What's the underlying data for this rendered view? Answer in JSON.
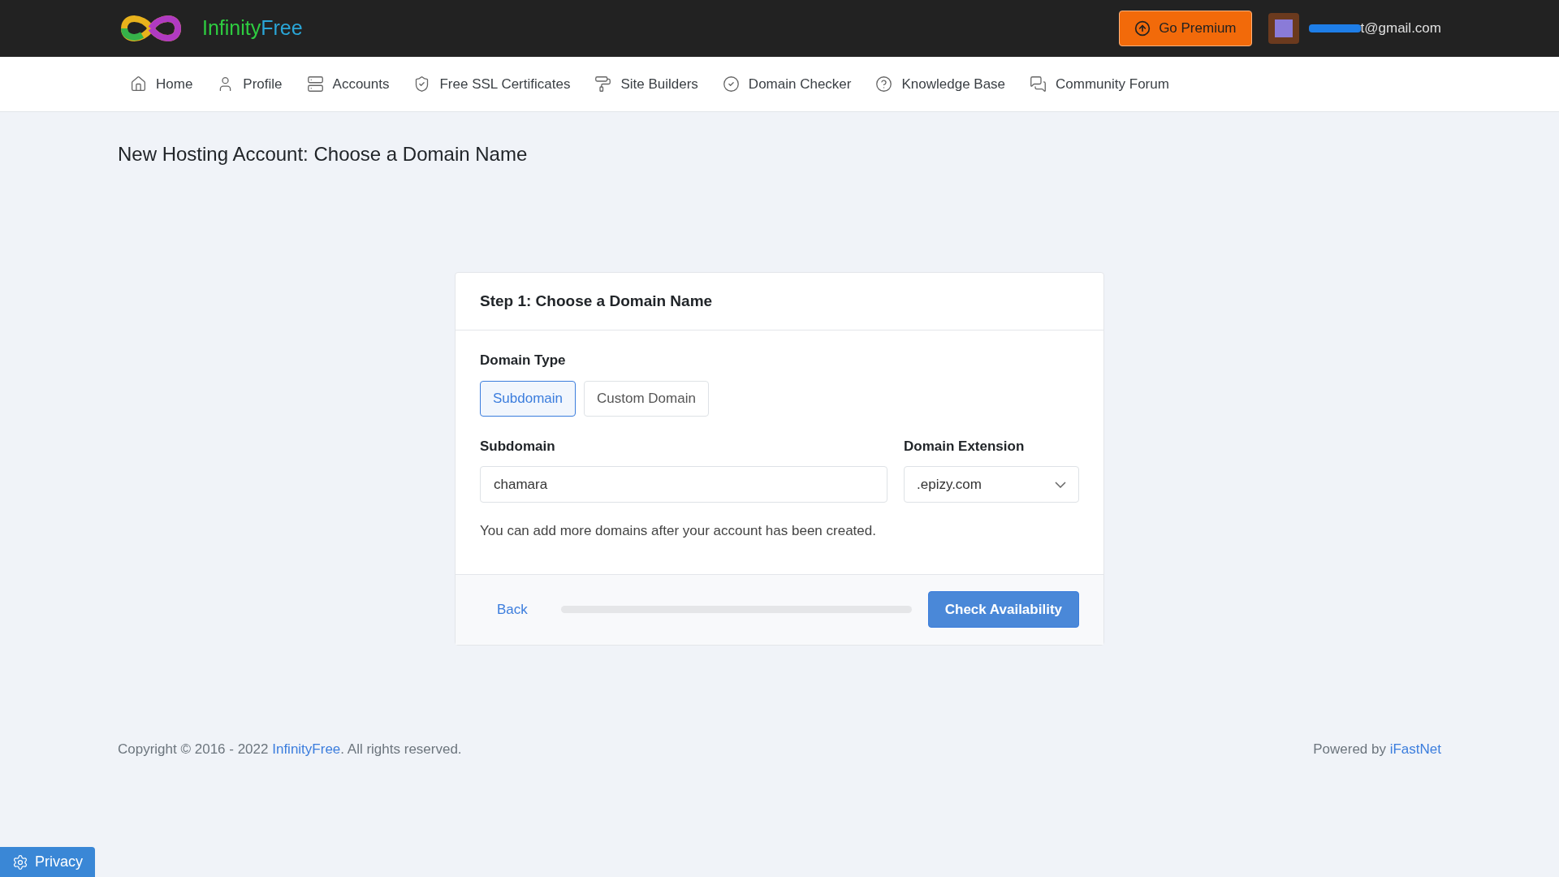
{
  "brand": {
    "name_part_1": "Infinity",
    "name_part_2": "Free"
  },
  "header": {
    "premium_button": "Go Premium",
    "user_email": "t@gmail.com"
  },
  "nav": [
    {
      "label": "Home"
    },
    {
      "label": "Profile"
    },
    {
      "label": "Accounts"
    },
    {
      "label": "Free SSL Certificates"
    },
    {
      "label": "Site Builders"
    },
    {
      "label": "Domain Checker"
    },
    {
      "label": "Knowledge Base"
    },
    {
      "label": "Community Forum"
    }
  ],
  "page_title": "New Hosting Account: Choose a Domain Name",
  "card": {
    "title": "Step 1: Choose a Domain Name",
    "domain_type_label": "Domain Type",
    "domain_types": [
      {
        "label": "Subdomain",
        "selected": true
      },
      {
        "label": "Custom Domain",
        "selected": false
      }
    ],
    "subdomain_label": "Subdomain",
    "subdomain_value": "chamara",
    "extension_label": "Domain Extension",
    "extension_value": ".epizy.com",
    "hint": "You can add more domains after your account has been created.",
    "back": "Back",
    "progress": {
      "level": 0
    },
    "submit": "Check Availability"
  },
  "footer": {
    "copyright_prefix": "Copyright © 2016 - 2022 ",
    "copyright_link": "InfinityFree",
    "copyright_suffix": ". All rights reserved.",
    "powered_prefix": "Powered by ",
    "powered_link": "iFastNet"
  },
  "privacy_button": "Privacy"
}
